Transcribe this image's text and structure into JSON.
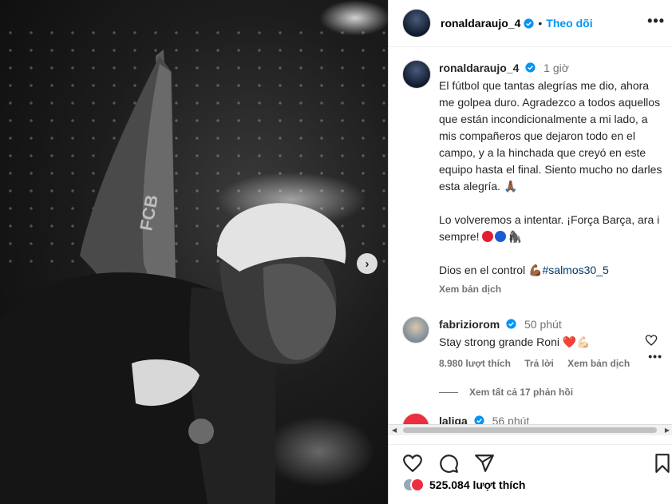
{
  "post": {
    "username": "ronaldaraujo_4",
    "follow_label": "Theo dõi",
    "separator": "•",
    "more_label": "•••",
    "next_label": "›"
  },
  "caption": {
    "username": "ronaldaraujo_4",
    "time": "1 giờ",
    "text": "El fútbol que tantas alegrías me dio, ahora me golpea duro. Agradezco a todos aquellos que están incondicionalmente a mi lado, a mis compañeros que dejaron todo en el campo, y a la hinchada que creyó en este equipo hasta el final. Siento mucho no darles esta alegría. 🙏🏾",
    "text2": "Lo volveremos a intentar. ¡Força Barça, ara i sempre!",
    "text3_prefix": "Dios en el control 💪🏾",
    "hashtag": "#salmos30_5",
    "translate": "Xem bản dịch"
  },
  "comments": [
    {
      "username": "fabriziorom",
      "time": "50 phút",
      "text": "Stay strong grande Roni ❤️💪🏻",
      "likes": "8.980 lượt thích",
      "reply": "Trả lời",
      "translate": "Xem bản dịch",
      "more": "•••",
      "view_replies": "Xem tất cả 17 phản hồi"
    },
    {
      "username": "laliga",
      "time": "56 phút"
    }
  ],
  "footer": {
    "likes": "525.084 lượt thích"
  },
  "colors": {
    "accent": "#0095f6",
    "verified": "#0095f6",
    "red_dot": "#e0202e",
    "blue_dot": "#1a5bd6"
  },
  "icons": [
    "verified-icon",
    "more-icon",
    "heart-icon",
    "comment-icon",
    "share-icon",
    "bookmark-icon",
    "chevron-right-icon"
  ]
}
